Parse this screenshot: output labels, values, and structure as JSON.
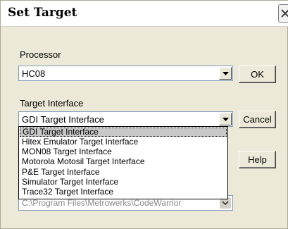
{
  "dialog": {
    "title": "Set Target"
  },
  "processor": {
    "label": "Processor",
    "value": "HC08"
  },
  "target_interface": {
    "label": "Target Interface",
    "value": "GDI Target Interface",
    "options": [
      "GDI Target Interface",
      "Hitex Emulator Target Interface",
      "MON08 Target Interface",
      "Motorola Motosil Target Interface",
      "P&E Target Interface",
      "Simulator Target Interface",
      "Trace32 Target Interface"
    ]
  },
  "hidden_field": {
    "value": "C:\\Program Files\\Metrowerks\\CodeWarrior"
  },
  "buttons": {
    "ok": "OK",
    "cancel": "Cancel",
    "help": "Help"
  },
  "icons": {
    "close": "close-icon",
    "dropdown": "chevron-down-icon"
  }
}
